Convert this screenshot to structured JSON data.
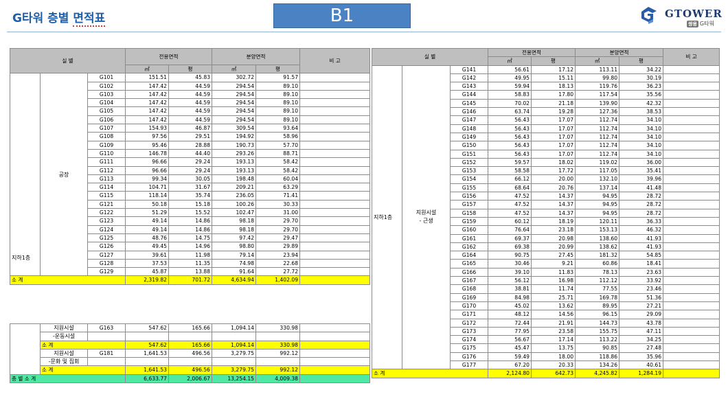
{
  "header": {
    "title_prefix": "G타워 층별 ",
    "title_underlined": "면적표",
    "floor": "B1",
    "logo_text": "GTOWER",
    "logo_badge": "쌍용",
    "logo_sub": "G타워"
  },
  "columns": {
    "room": "실 별",
    "exclusive": "전용면적",
    "sale": "분양면적",
    "remark": "비 고",
    "sqm": "㎡",
    "pyeong": "평"
  },
  "left": {
    "floor_label": "지하1층",
    "group_label": "공장",
    "rows": [
      [
        "G101",
        "151.51",
        "45.83",
        "302.72",
        "91.57"
      ],
      [
        "G102",
        "147.42",
        "44.59",
        "294.54",
        "89.10"
      ],
      [
        "G103",
        "147.42",
        "44.59",
        "294.54",
        "89.10"
      ],
      [
        "G104",
        "147.42",
        "44.59",
        "294.54",
        "89.10"
      ],
      [
        "G105",
        "147.42",
        "44.59",
        "294.54",
        "89.10"
      ],
      [
        "G106",
        "147.42",
        "44.59",
        "294.54",
        "89.10"
      ],
      [
        "G107",
        "154.93",
        "46.87",
        "309.54",
        "93.64"
      ],
      [
        "G108",
        "97.56",
        "29.51",
        "194.92",
        "58.96"
      ],
      [
        "G109",
        "95.46",
        "28.88",
        "190.73",
        "57.70"
      ],
      [
        "G110",
        "146.78",
        "44.40",
        "293.26",
        "88.71"
      ],
      [
        "G111",
        "96.66",
        "29.24",
        "193.13",
        "58.42"
      ],
      [
        "G112",
        "96.66",
        "29.24",
        "193.13",
        "58.42"
      ],
      [
        "G113",
        "99.34",
        "30.05",
        "198.48",
        "60.04"
      ],
      [
        "G114",
        "104.71",
        "31.67",
        "209.21",
        "63.29"
      ],
      [
        "G115",
        "118.14",
        "35.74",
        "236.05",
        "71.41"
      ],
      [
        "G121",
        "50.18",
        "15.18",
        "100.26",
        "30.33"
      ],
      [
        "G122",
        "51.29",
        "15.52",
        "102.47",
        "31.00"
      ],
      [
        "G123",
        "49.14",
        "14.86",
        "98.18",
        "29.70"
      ],
      [
        "G124",
        "49.14",
        "14.86",
        "98.18",
        "29.70"
      ],
      [
        "G125",
        "48.76",
        "14.75",
        "97.42",
        "29.47"
      ],
      [
        "G126",
        "49.45",
        "14.96",
        "98.80",
        "29.89"
      ],
      [
        "G127",
        "39.61",
        "11.98",
        "79.14",
        "23.94"
      ],
      [
        "G128",
        "37.53",
        "11.35",
        "74.98",
        "22.68"
      ],
      [
        "G129",
        "45.87",
        "13.88",
        "91.64",
        "27.72"
      ]
    ],
    "subtotal": {
      "label": "소 계",
      "values": [
        "2,319.82",
        "701.72",
        "4,634.94",
        "1,402.09"
      ]
    }
  },
  "left2": {
    "groups": [
      {
        "label_line1": "지원시설",
        "label_line2": "-운동시설",
        "room": "G163",
        "values": [
          "547.62",
          "165.66",
          "1,094.14",
          "330.98"
        ],
        "subtotal_label": "소 계",
        "subtotal": [
          "547.62",
          "165.66",
          "1,094.14",
          "330.98"
        ]
      },
      {
        "label_line1": "지원시설",
        "label_line2": "-문화 및 집회",
        "room": "G181",
        "values": [
          "1,641.53",
          "496.56",
          "3,279.75",
          "992.12"
        ],
        "subtotal_label": "소 계",
        "subtotal": [
          "1,641.53",
          "496.56",
          "3,279.75",
          "992.12"
        ]
      }
    ],
    "total": {
      "label": "층 별 소 계",
      "values": [
        "6,633.77",
        "2,006.67",
        "13,254.15",
        "4,009.38"
      ]
    }
  },
  "right": {
    "floor_label": "지하1층",
    "group_line1": "지원시설",
    "group_line2": "- 근생",
    "rows": [
      [
        "G141",
        "56.61",
        "17.12",
        "113.11",
        "34.22"
      ],
      [
        "G142",
        "49.95",
        "15.11",
        "99.80",
        "30.19"
      ],
      [
        "G143",
        "59.94",
        "18.13",
        "119.76",
        "36.23"
      ],
      [
        "G144",
        "58.83",
        "17.80",
        "117.54",
        "35.56"
      ],
      [
        "G145",
        "70.02",
        "21.18",
        "139.90",
        "42.32"
      ],
      [
        "G146",
        "63.74",
        "19.28",
        "127.36",
        "38.53"
      ],
      [
        "G147",
        "56.43",
        "17.07",
        "112.74",
        "34.10"
      ],
      [
        "G148",
        "56.43",
        "17.07",
        "112.74",
        "34.10"
      ],
      [
        "G149",
        "56.43",
        "17.07",
        "112.74",
        "34.10"
      ],
      [
        "G150",
        "56.43",
        "17.07",
        "112.74",
        "34.10"
      ],
      [
        "G151",
        "56.43",
        "17.07",
        "112.74",
        "34.10"
      ],
      [
        "G152",
        "59.57",
        "18.02",
        "119.02",
        "36.00"
      ],
      [
        "G153",
        "58.58",
        "17.72",
        "117.05",
        "35.41"
      ],
      [
        "G154",
        "66.12",
        "20.00",
        "132.10",
        "39.96"
      ],
      [
        "G155",
        "68.64",
        "20.76",
        "137.14",
        "41.48"
      ],
      [
        "G156",
        "47.52",
        "14.37",
        "94.95",
        "28.72"
      ],
      [
        "G157",
        "47.52",
        "14.37",
        "94.95",
        "28.72"
      ],
      [
        "G158",
        "47.52",
        "14.37",
        "94.95",
        "28.72"
      ],
      [
        "G159",
        "60.12",
        "18.19",
        "120.11",
        "36.33"
      ],
      [
        "G160",
        "76.64",
        "23.18",
        "153.13",
        "46.32"
      ],
      [
        "G161",
        "69.37",
        "20.98",
        "138.60",
        "41.93"
      ],
      [
        "G162",
        "69.38",
        "20.99",
        "138.62",
        "41.93"
      ],
      [
        "G164",
        "90.75",
        "27.45",
        "181.32",
        "54.85"
      ],
      [
        "G165",
        "30.46",
        "9.21",
        "60.86",
        "18.41"
      ],
      [
        "G166",
        "39.10",
        "11.83",
        "78.13",
        "23.63"
      ],
      [
        "G167",
        "56.12",
        "16.98",
        "112.12",
        "33.92"
      ],
      [
        "G168",
        "38.81",
        "11.74",
        "77.55",
        "23.46"
      ],
      [
        "G169",
        "84.98",
        "25.71",
        "169.78",
        "51.36"
      ],
      [
        "G170",
        "45.02",
        "13.62",
        "89.95",
        "27.21"
      ],
      [
        "G171",
        "48.12",
        "14.56",
        "96.15",
        "29.09"
      ],
      [
        "G172",
        "72.44",
        "21.91",
        "144.73",
        "43.78"
      ],
      [
        "G173",
        "77.95",
        "23.58",
        "155.75",
        "47.11"
      ],
      [
        "G174",
        "56.67",
        "17.14",
        "113.22",
        "34.25"
      ],
      [
        "G175",
        "45.47",
        "13.75",
        "90.85",
        "27.48"
      ],
      [
        "G176",
        "59.49",
        "18.00",
        "118.86",
        "35.96"
      ],
      [
        "G177",
        "67.20",
        "20.33",
        "134.26",
        "40.61"
      ]
    ],
    "subtotal": {
      "label": "소 계",
      "values": [
        "2,124.80",
        "642.73",
        "4,245.82",
        "1,284.19"
      ]
    }
  }
}
